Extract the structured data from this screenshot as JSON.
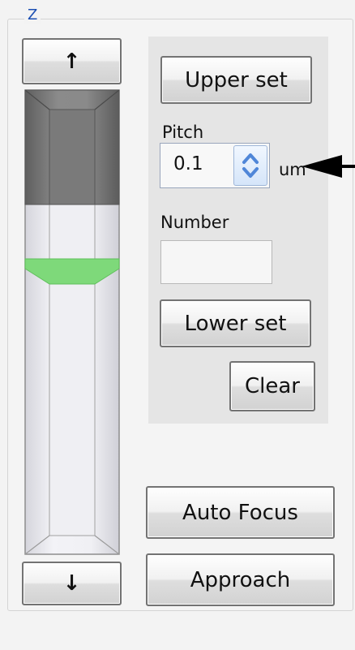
{
  "group": {
    "title": "Z"
  },
  "buttons": {
    "up_icon": "up-arrow-icon",
    "down_icon": "down-arrow-icon",
    "up_glyph": "↑",
    "down_glyph": "↓",
    "upper_set": "Upper set",
    "lower_set": "Lower set",
    "clear": "Clear",
    "auto_focus": "Auto Focus",
    "approach": "Approach"
  },
  "pitch": {
    "label": "Pitch",
    "value": "0.1",
    "unit": "um"
  },
  "number": {
    "label": "Number",
    "value": ""
  },
  "colors": {
    "accent_green": "#7ed97a",
    "slider_dark": "#6e6e6e",
    "slider_light": "#e8e8ee",
    "spin_blue": "#4f86d8"
  }
}
